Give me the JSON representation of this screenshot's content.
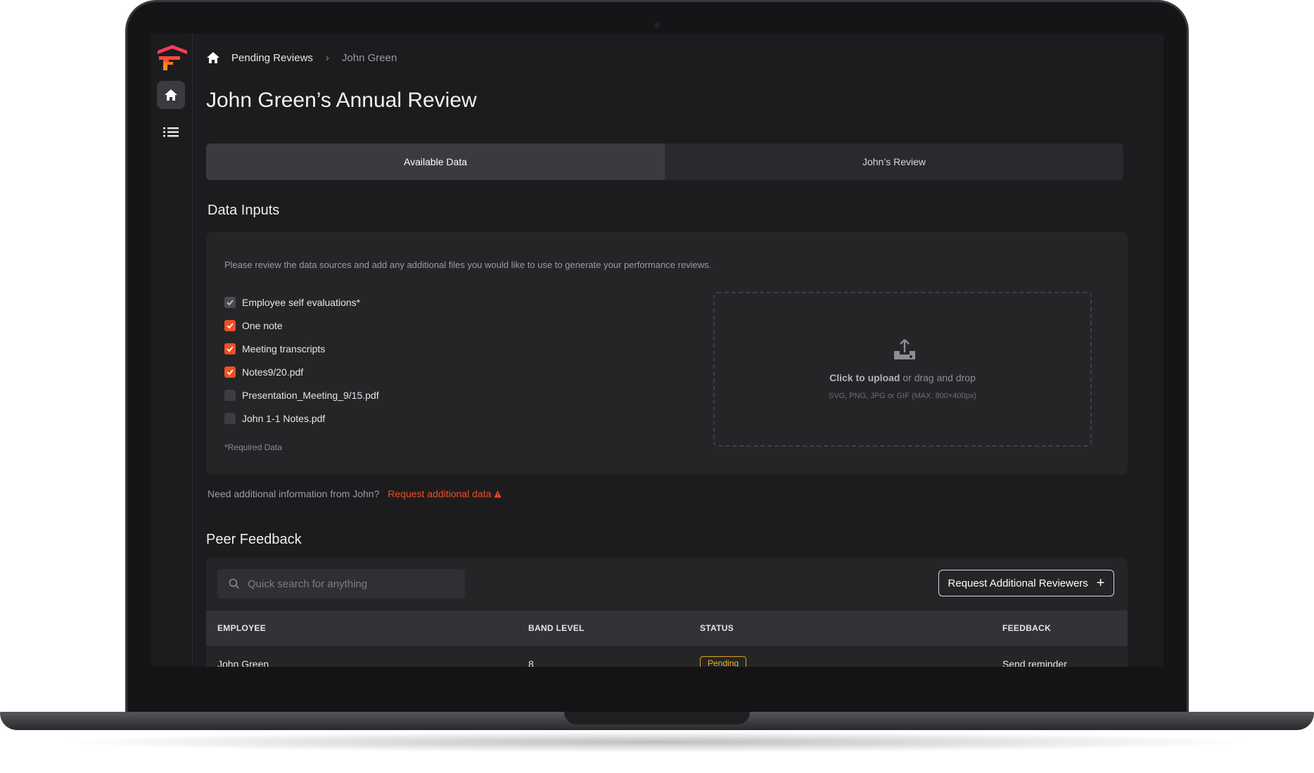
{
  "breadcrumb": {
    "items": [
      "Pending Reviews",
      "John Green"
    ]
  },
  "page": {
    "title": "John Green’s Annual Review"
  },
  "tabs": [
    {
      "label": "Available Data",
      "active": true
    },
    {
      "label": "John’s Review",
      "active": false
    }
  ],
  "data_inputs": {
    "title": "Data Inputs",
    "description": "Please review the data sources and add any additional files you would like to use to generate your performance reviews.",
    "items": [
      {
        "label": "Employee self evaluations*",
        "state": "checked-disabled"
      },
      {
        "label": "One note",
        "state": "checked"
      },
      {
        "label": "Meeting transcripts",
        "state": "checked"
      },
      {
        "label": "Notes9/20.pdf",
        "state": "checked"
      },
      {
        "label": "Presentation_Meeting_9/15.pdf",
        "state": "unchecked"
      },
      {
        "label": "John 1-1 Notes.pdf",
        "state": "unchecked"
      }
    ],
    "required_note": "*Required Data",
    "upload": {
      "click_text": "Click to upload",
      "drag_text": " or drag and drop",
      "formats": "SVG, PNG, JPG or GIF (MAX. 800×400px)"
    }
  },
  "need_info": {
    "question": "Need additional information from John?",
    "link": "Request additional data"
  },
  "peer_feedback": {
    "title": "Peer Feedback",
    "search_placeholder": "Quick search for anything",
    "request_button": "Request Additional Reviewers",
    "columns": [
      "EMPLOYEE",
      "BAND LEVEL",
      "STATUS",
      "FEEDBACK"
    ],
    "rows": [
      {
        "employee": "John Green",
        "band": "8",
        "status": "Pending",
        "feedback": "Send reminder"
      }
    ]
  },
  "colors": {
    "accent": "#f04e23",
    "background": "#1c1c1f",
    "pending": "#d9a21b"
  },
  "icons": [
    "logo-icon",
    "home-icon",
    "list-icon",
    "chevron-right-icon",
    "check-icon",
    "upload-icon",
    "warning-icon",
    "search-icon",
    "plus-icon"
  ]
}
